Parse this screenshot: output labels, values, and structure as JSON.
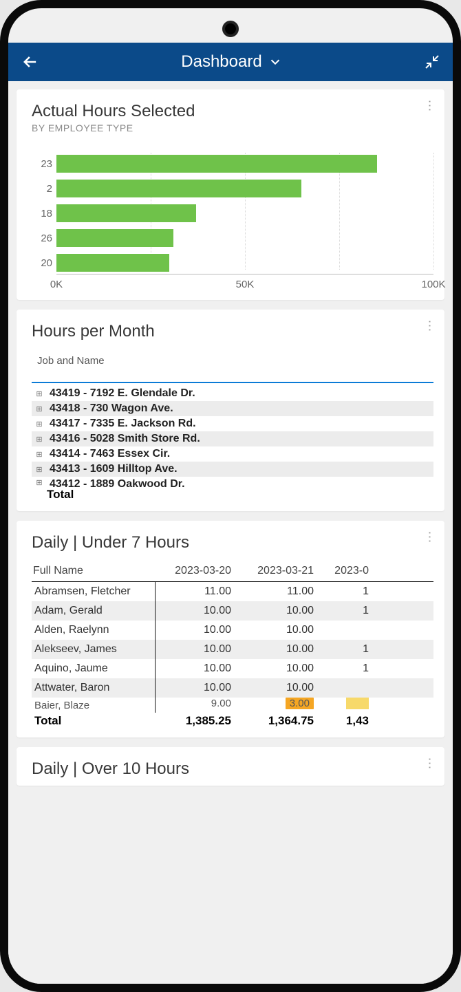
{
  "header": {
    "title": "Dashboard"
  },
  "card1": {
    "title": "Actual Hours Selected",
    "subtitle": "By Employee Type"
  },
  "chart_data": {
    "type": "bar",
    "orientation": "horizontal",
    "categories": [
      "23",
      "2",
      "18",
      "26",
      "20"
    ],
    "values": [
      85000,
      65000,
      37000,
      31000,
      30000
    ],
    "xlabel": "",
    "ylabel": "",
    "xlim": [
      0,
      100000
    ],
    "x_ticks": [
      "0K",
      "50K",
      "100K"
    ],
    "grid": true,
    "title": "Actual Hours Selected",
    "subtitle": "By Employee Type"
  },
  "card2": {
    "title": "Hours per Month",
    "column_header": "Job and Name",
    "rows": [
      {
        "label": "43419 - 7192 E. Glendale Dr."
      },
      {
        "label": "43418 - 730 Wagon Ave."
      },
      {
        "label": "43417 - 7335 E. Jackson Rd."
      },
      {
        "label": "43416 - 5028 Smith Store Rd."
      },
      {
        "label": "43414 - 7463 Essex Cir."
      },
      {
        "label": "43413 - 1609 Hilltop Ave."
      },
      {
        "label": "43412 - 1889 Oakwood Dr."
      }
    ],
    "total_label": "Total"
  },
  "card3": {
    "title": "Daily | Under 7 Hours",
    "columns": [
      "Full Name",
      "2023-03-20",
      "2023-03-21",
      "2023-0"
    ],
    "rows": [
      {
        "name": "Abramsen, Fletcher",
        "v1": "11.00",
        "v2": "11.00",
        "v3": "1"
      },
      {
        "name": "Adam, Gerald",
        "v1": "10.00",
        "v2": "10.00",
        "v3": "1"
      },
      {
        "name": "Alden, Raelynn",
        "v1": "10.00",
        "v2": "10.00",
        "v3": ""
      },
      {
        "name": "Alekseev, James",
        "v1": "10.00",
        "v2": "10.00",
        "v3": "1"
      },
      {
        "name": "Aquino, Jaume",
        "v1": "10.00",
        "v2": "10.00",
        "v3": "1"
      },
      {
        "name": "Attwater, Baron",
        "v1": "10.00",
        "v2": "10.00",
        "v3": ""
      }
    ],
    "partial_row": {
      "name": "Baier, Blaze",
      "v1": "9.00",
      "v2": "3.00",
      "v3": ""
    },
    "total": {
      "label": "Total",
      "v1": "1,385.25",
      "v2": "1,364.75",
      "v3": "1,43"
    }
  },
  "card4": {
    "title": "Daily | Over 10 Hours"
  }
}
